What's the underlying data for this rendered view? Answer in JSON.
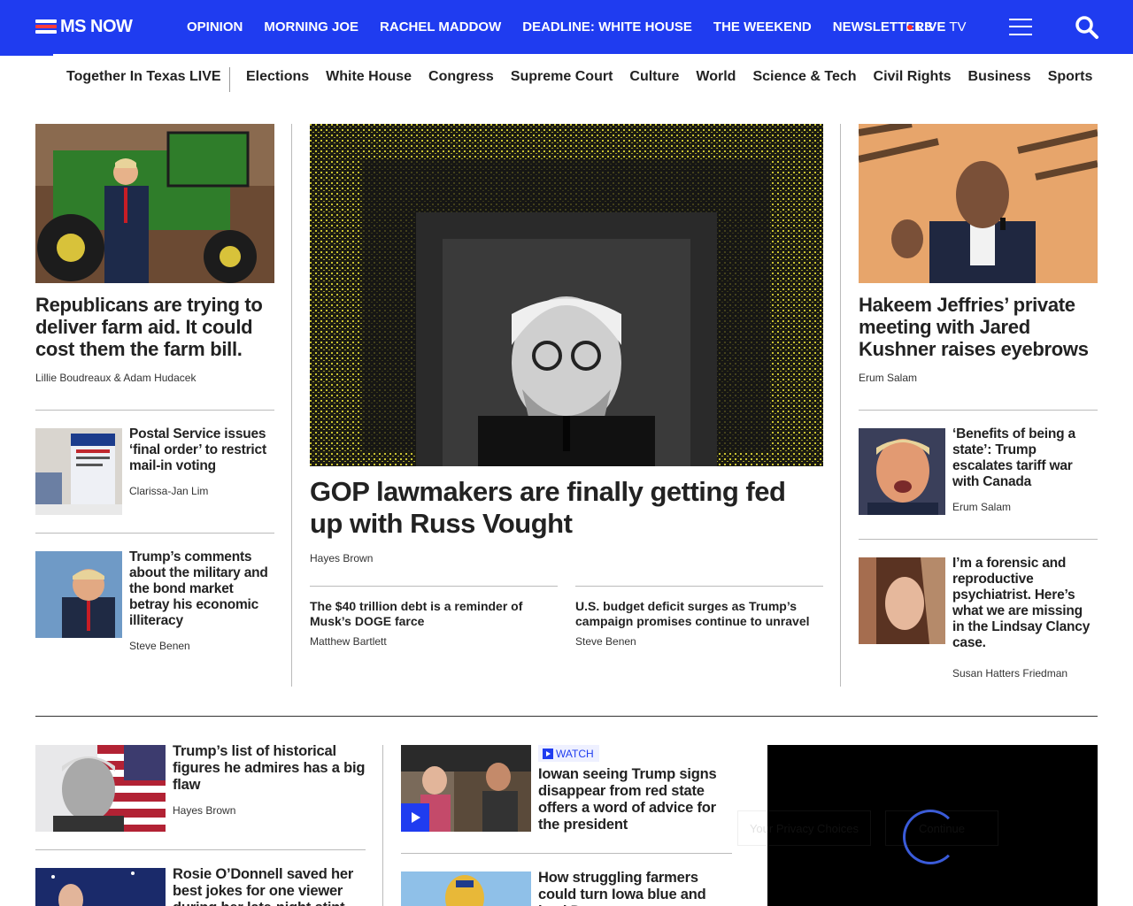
{
  "header": {
    "logo_text": "MS NOW",
    "nav": [
      "OPINION",
      "MORNING JOE",
      "RACHEL MADDOW",
      "DEADLINE: WHITE HOUSE",
      "THE WEEKEND",
      "NEWSLETTERS"
    ],
    "live_label": "LIVE",
    "live_suffix": "TV",
    "brand_color": "#1f3cf0",
    "live_dot_color": "#ff2b2b"
  },
  "subnav": {
    "featured": "Together In Texas LIVE",
    "topics": [
      "Elections",
      "White House",
      "Congress",
      "Supreme Court",
      "Culture",
      "World",
      "Science & Tech",
      "Civil Rights",
      "Business",
      "Sports"
    ]
  },
  "left_col": {
    "lead": {
      "headline": "Republicans are trying to deliver farm aid. It could cost them the farm bill.",
      "byline": "Lillie Boudreaux & Adam Hudacek"
    },
    "items": [
      {
        "headline": "Postal Service issues ‘final order’ to restrict mail-in voting",
        "byline": "Clarissa-Jan Lim"
      },
      {
        "headline": "Trump’s comments about the military and the bond market betray his economic illiteracy",
        "byline": "Steve Benen"
      }
    ]
  },
  "center_col": {
    "main": {
      "headline": "GOP lawmakers are finally getting fed up with Russ Vought",
      "byline": "Hayes Brown"
    },
    "related": [
      {
        "headline": "The $40 trillion debt is a reminder of Musk’s DOGE farce",
        "byline": "Matthew Bartlett"
      },
      {
        "headline": "U.S. budget deficit surges as Trump’s campaign promises continue to unravel",
        "byline": "Steve Benen"
      }
    ]
  },
  "right_col": {
    "lead": {
      "headline": "Hakeem Jeffries’ private meeting with Jared Kushner raises eyebrows",
      "byline": "Erum Salam"
    },
    "items": [
      {
        "headline": "‘Benefits of being a state’: Trump escalates tariff war with Canada",
        "byline": "Erum Salam"
      },
      {
        "headline": "I’m a forensic and reproductive psychiatrist. Here’s what we are missing in the Lindsay Clancy case.",
        "byline": "Susan Hatters Friedman"
      }
    ]
  },
  "lower": {
    "col1": [
      {
        "headline": "Trump’s list of historical figures he admires has a big flaw",
        "byline": "Hayes Brown"
      },
      {
        "headline": "Rosie O’Donnell saved her best jokes for one viewer during her late-night stint"
      }
    ],
    "col2": [
      {
        "badge": "WATCH",
        "headline": "Iowan seeing Trump signs disappear from red state offers a word of advice for the president"
      },
      {
        "headline": "How struggling farmers could turn Iowa blue and lead D"
      }
    ]
  },
  "consent_overlay": {
    "privacy_button": "Your Privacy Choices",
    "continue_button": "Continue"
  }
}
